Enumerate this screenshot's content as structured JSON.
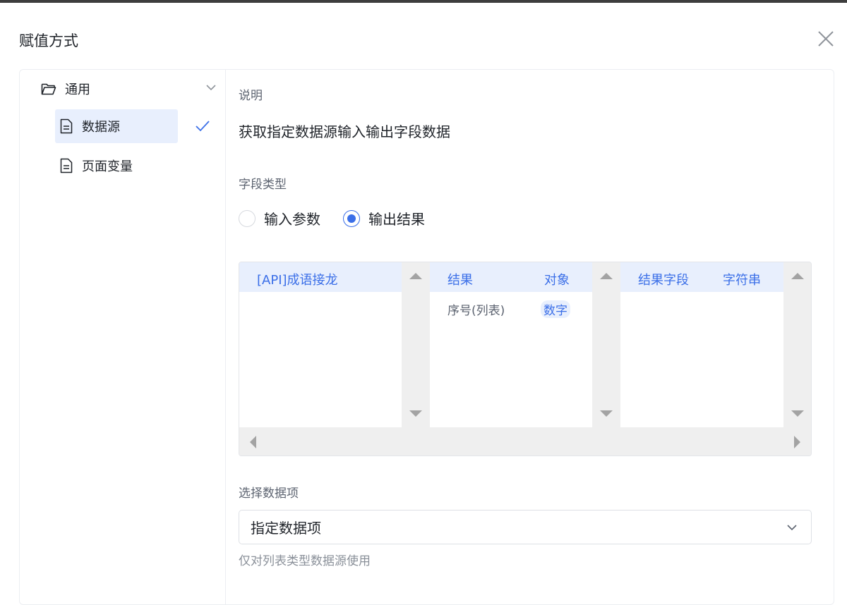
{
  "dialog": {
    "title": "赋值方式"
  },
  "sidebar": {
    "group": {
      "label": "通用"
    },
    "items": [
      {
        "label": "数据源",
        "active": true
      },
      {
        "label": "页面变量",
        "active": false
      }
    ]
  },
  "main": {
    "description_label": "说明",
    "description_text": "获取指定数据源输入输出字段数据",
    "field_type_label": "字段类型",
    "field_type_options": [
      {
        "label": "输入参数",
        "checked": false
      },
      {
        "label": "输出结果",
        "checked": true
      }
    ],
    "cascader": {
      "columns": [
        {
          "header": [
            "[API]成语接龙"
          ],
          "rows": []
        },
        {
          "header": [
            "结果",
            "对象"
          ],
          "rows": [
            {
              "name": "序号(列表)",
              "type": "数字"
            }
          ]
        },
        {
          "header": [
            "结果字段",
            "字符串"
          ],
          "rows": []
        }
      ]
    },
    "select_label": "选择数据项",
    "select_value": "指定数据项",
    "select_hint": "仅对列表类型数据源使用"
  },
  "colors": {
    "accent": "#3b6fe8",
    "accent_bg": "#e8effd",
    "border": "#eceef2"
  },
  "icons": [
    "folder-open-icon",
    "chevron-down-icon",
    "document-icon",
    "check-icon",
    "close-icon"
  ]
}
